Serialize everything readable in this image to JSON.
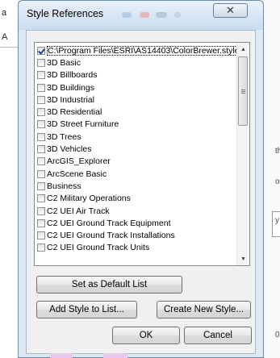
{
  "dialog": {
    "title": "Style References",
    "close_glyph": "✕"
  },
  "styles": {
    "items": [
      {
        "label": "C:\\Program Files\\ESRI\\AS14403\\ColorBrewer.style",
        "checked": true
      },
      {
        "label": "3D Basic",
        "checked": false
      },
      {
        "label": "3D Billboards",
        "checked": false
      },
      {
        "label": "3D Buildings",
        "checked": false
      },
      {
        "label": "3D Industrial",
        "checked": false
      },
      {
        "label": "3D Residential",
        "checked": false
      },
      {
        "label": "3D Street Furniture",
        "checked": false
      },
      {
        "label": "3D Trees",
        "checked": false
      },
      {
        "label": "3D Vehicles",
        "checked": false
      },
      {
        "label": "ArcGIS_Explorer",
        "checked": false
      },
      {
        "label": "ArcScene Basic",
        "checked": false
      },
      {
        "label": "Business",
        "checked": false
      },
      {
        "label": "C2 Military Operations",
        "checked": false
      },
      {
        "label": "C2 UEI Air Track",
        "checked": false
      },
      {
        "label": "C2 UEI Ground Track Equipment",
        "checked": false
      },
      {
        "label": "C2 UEI Ground Track Installations",
        "checked": false
      },
      {
        "label": "C2 UEI Ground Track Units",
        "checked": false
      }
    ],
    "scroll_up_glyph": "▲",
    "scroll_down_glyph": "▼"
  },
  "buttons": {
    "set_default": "Set as Default List",
    "add_style": "Add Style to List...",
    "create_style": "Create New Style...",
    "ok": "OK",
    "cancel": "Cancel"
  },
  "background": {
    "left_chars": [
      "a",
      "A"
    ],
    "right_chars": [
      "th",
      "or",
      "y",
      "0"
    ]
  }
}
